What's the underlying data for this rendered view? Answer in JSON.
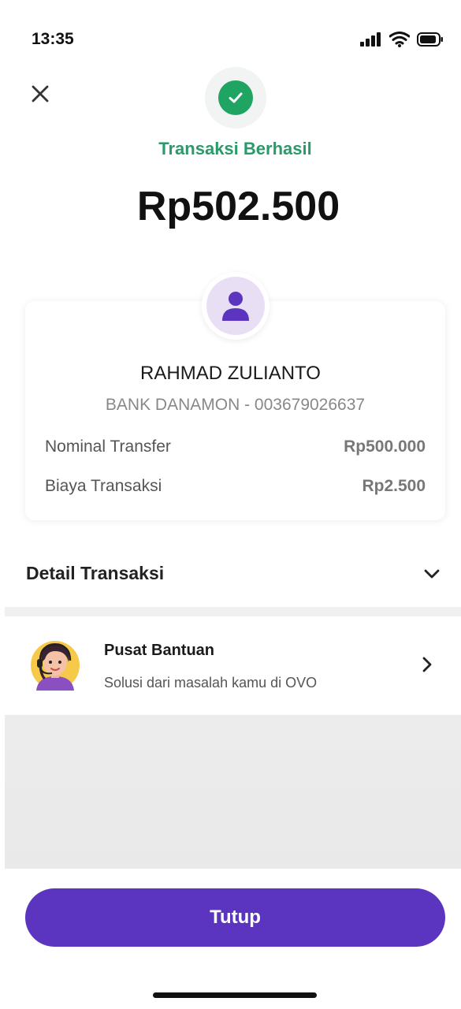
{
  "status_bar": {
    "time": "13:35"
  },
  "header": {
    "status": "Transaksi Berhasil",
    "amount": "Rp502.500"
  },
  "recipient": {
    "name": "RAHMAD ZULIANTO",
    "bank": "BANK DANAMON - 003679026637"
  },
  "details": [
    {
      "label": "Nominal Transfer",
      "value": "Rp500.000"
    },
    {
      "label": "Biaya Transaksi",
      "value": "Rp2.500"
    }
  ],
  "detail_section": {
    "title": "Detail Transaksi"
  },
  "help": {
    "title": "Pusat Bantuan",
    "subtitle": "Solusi dari masalah kamu di OVO"
  },
  "footer": {
    "close_label": "Tutup"
  },
  "colors": {
    "success": "#1fa561",
    "status_text": "#2a9a6a",
    "primary": "#5b35bf",
    "avatar_bg": "#e8dff5"
  }
}
